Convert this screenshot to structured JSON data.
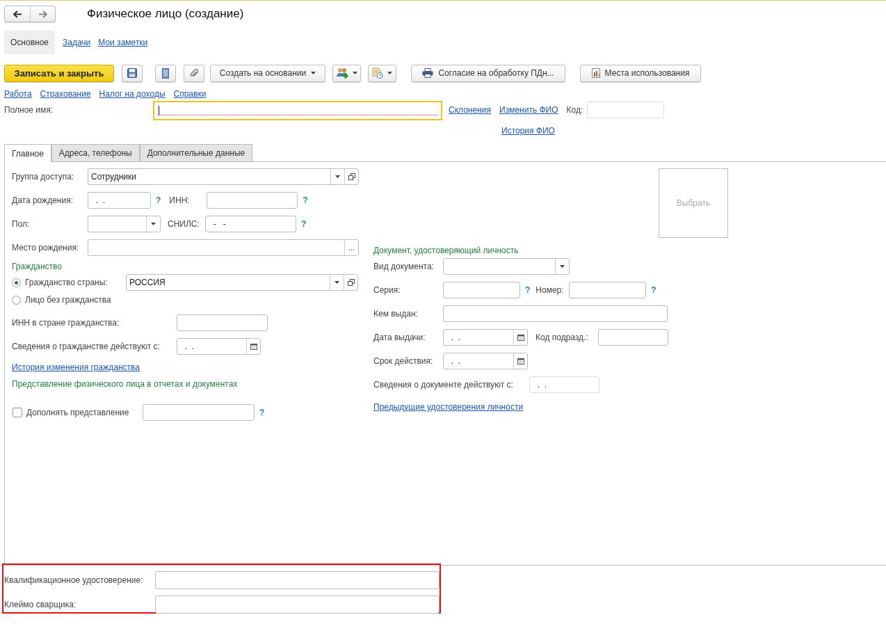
{
  "window": {
    "title": "Физическое лицо (создание)"
  },
  "sections": [
    {
      "label": "Основное",
      "selected": true
    },
    {
      "label": "Задачи",
      "selected": false
    },
    {
      "label": "Мои заметки",
      "selected": false
    }
  ],
  "toolbar": {
    "primary": "Записать и закрыть",
    "create_based_on": "Создать на основании",
    "consent": "Согласие на обработку ПДн...",
    "usages": "Места использования"
  },
  "links": [
    "Работа",
    "Страхование",
    "Налог на доходы",
    "Справки"
  ],
  "full_name": {
    "label": "Полное имя:",
    "focused": true,
    "links": [
      "Склонения",
      "Изменить ФИО"
    ],
    "code_label": "Код:",
    "history_link": "История ФИО"
  },
  "tabs": [
    {
      "label": "Главное",
      "selected": true
    },
    {
      "label": "Адреса, телефоны",
      "selected": false
    },
    {
      "label": "Дополнительные данные",
      "selected": false
    }
  ],
  "main": {
    "access_group": {
      "label": "Группа доступа:",
      "value": "Сотрудники"
    },
    "birth_date": {
      "label": "Дата рождения:",
      "value": ".  .",
      "hint": "?"
    },
    "inn": {
      "label": "ИНН:",
      "hint": "?"
    },
    "gender": {
      "label": "Пол:"
    },
    "snils": {
      "label": "СНИЛС:",
      "value": "-   -",
      "hint": "?"
    },
    "birth_place": {
      "label": "Место рождения:",
      "button": "..."
    }
  },
  "citizenship": {
    "title": "Гражданство",
    "options": [
      {
        "label": "Гражданство страны:",
        "selected": true
      },
      {
        "label": "Лицо без гражданства",
        "selected": false
      }
    ],
    "country": "РОССИЯ",
    "inn_label": "ИНН в стране гражданства:",
    "since_label": "Сведения о гражданстве действуют с:",
    "since_value": ".  .",
    "history_link": "История изменения гражданства"
  },
  "presentation": {
    "title": "Представление физического лица в отчетах и документах",
    "checkbox_label": "Дополнять представление",
    "checked": false,
    "hint": "?"
  },
  "photo": {
    "label": "Выбрать"
  },
  "document": {
    "title": "Документ, удостоверяющий личность",
    "type_label": "Вид документа:",
    "series_label": "Серия:",
    "series_hint": "?",
    "number_label": "Номер:",
    "number_hint": "?",
    "issued_by_label": "Кем выдан:",
    "issue_date_label": "Дата выдачи:",
    "issue_date_value": ".  .",
    "dept_code_label": "Код подразд.:",
    "expiry_label": "Срок действия:",
    "expiry_value": ".  .",
    "since_label": "Сведения о документе действуют с:",
    "since_value": ".  .",
    "previous_link": "Предыдущие удостоверения личности"
  },
  "bottom": {
    "fields": [
      {
        "label": "Квалификационное удостоверение:"
      },
      {
        "label": "Клеймо сварщика:"
      }
    ]
  }
}
